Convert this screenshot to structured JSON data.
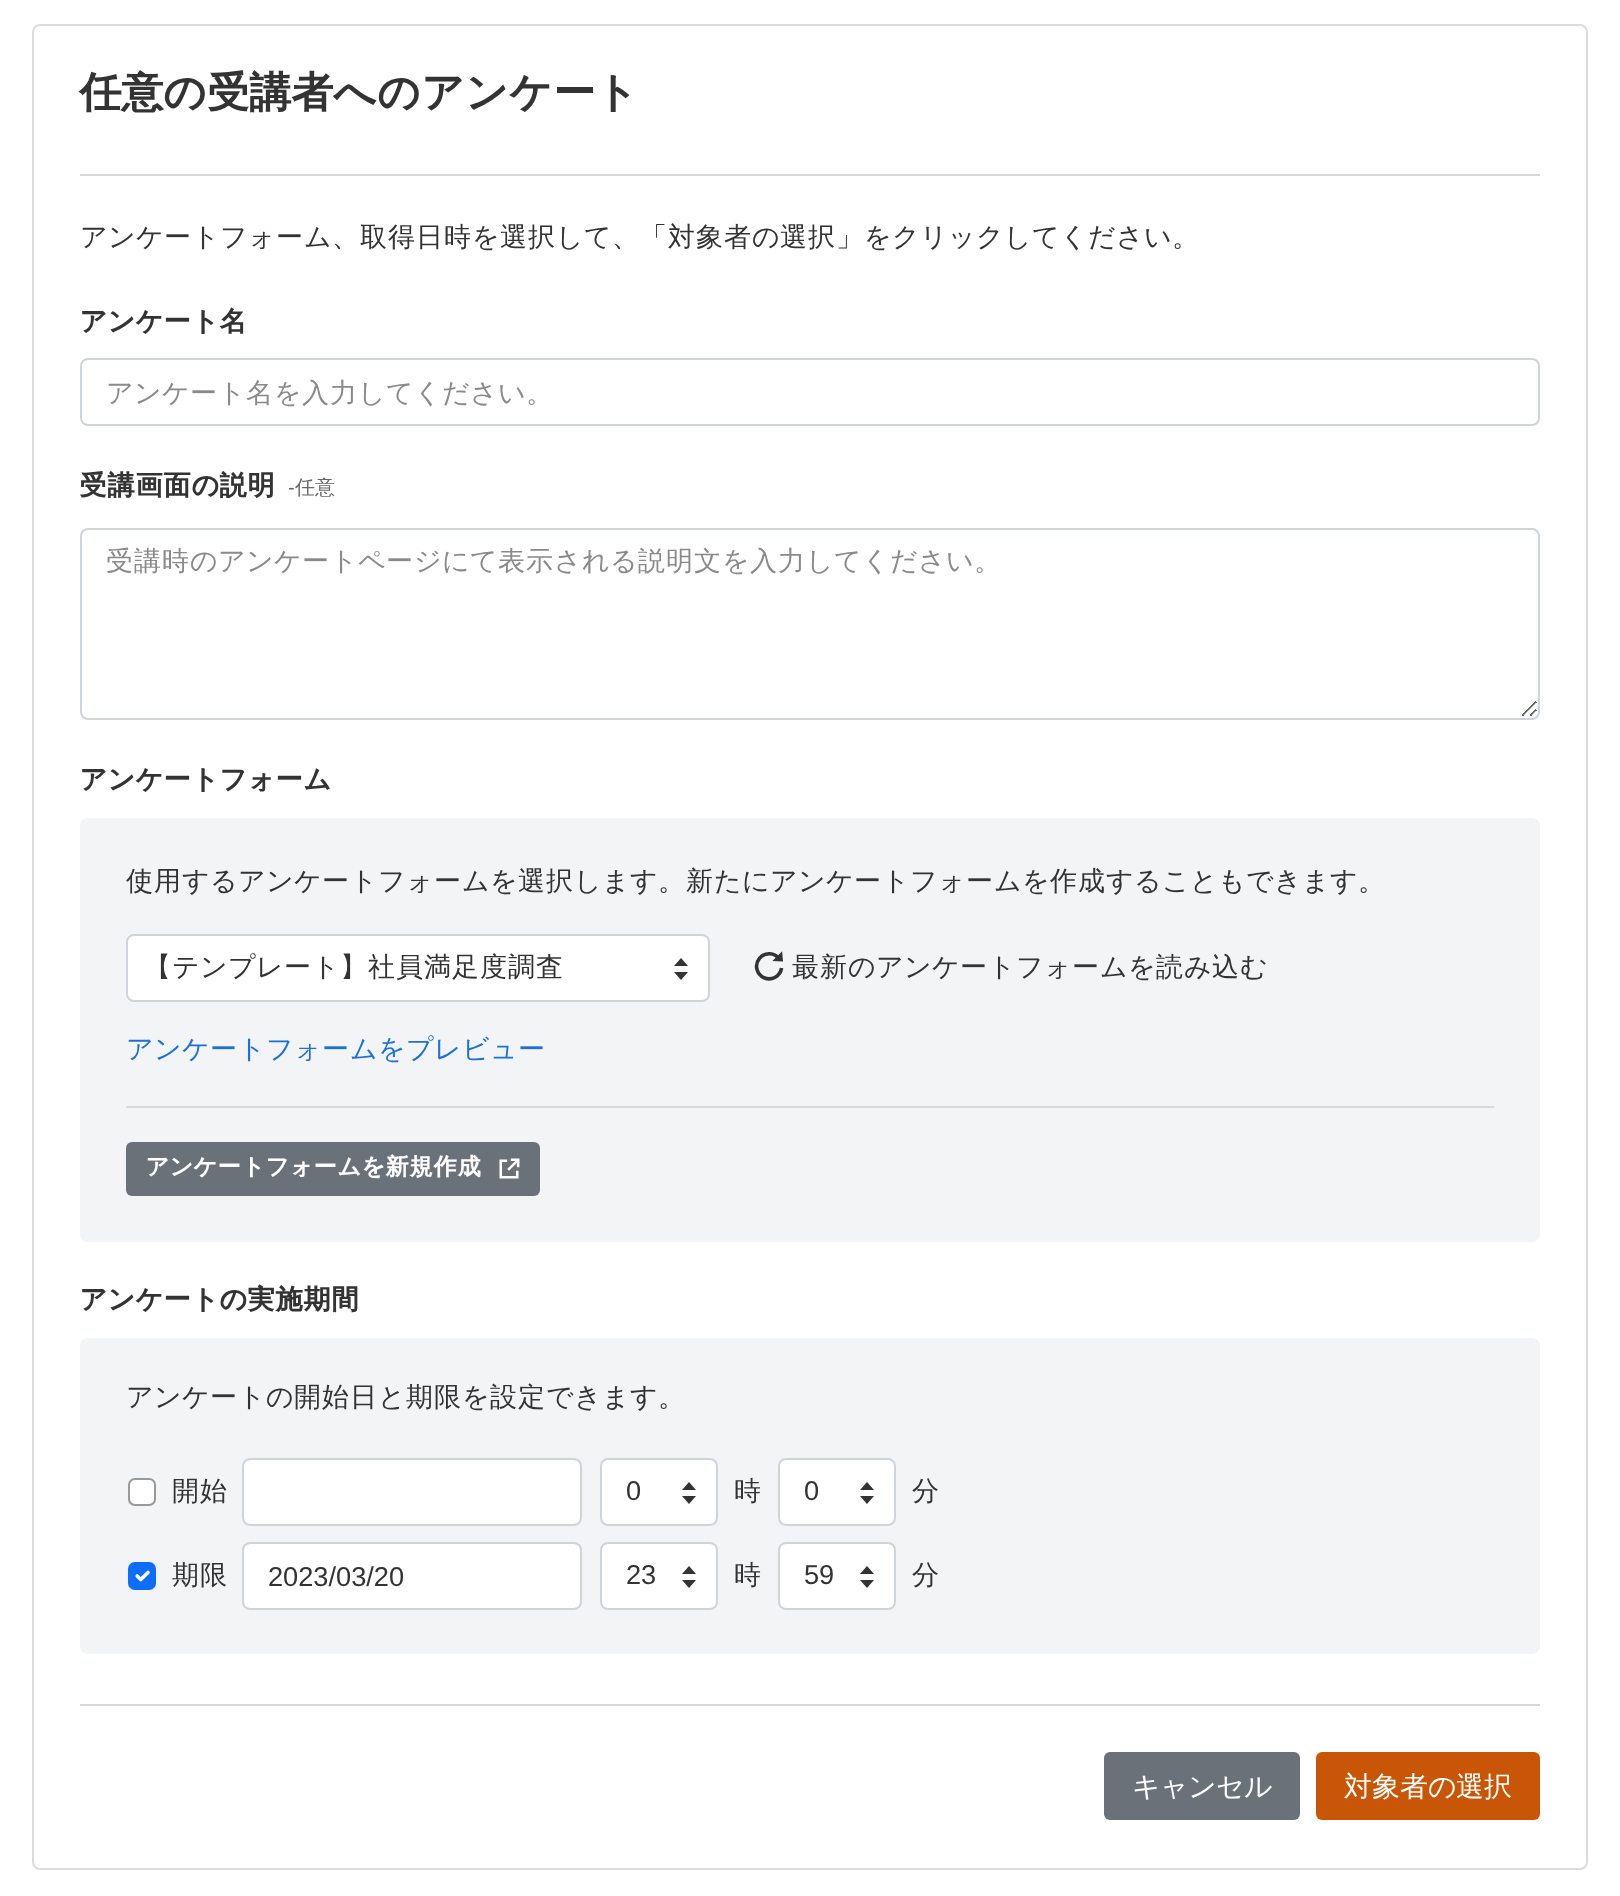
{
  "title": "任意の受講者へのアンケート",
  "instruction": "アンケートフォーム、取得日時を選択して、「対象者の選択」をクリックしてください。",
  "fields": [
    {
      "kind": "input",
      "label": "アンケート名",
      "placeholder": "アンケート名を入力してください。"
    },
    {
      "kind": "textarea",
      "label": "受講画面の説明",
      "optional_tag": "-任意",
      "placeholder": "受講時のアンケートページにて表示される説明文を入力してください。"
    }
  ],
  "form_section": {
    "heading": "アンケートフォーム",
    "description": "使用するアンケートフォームを選択します。新たにアンケートフォームを作成することもできます。",
    "select": {
      "value": "【テンプレート】社員満足度調査"
    },
    "reload_label": "最新のアンケートフォームを読み込む",
    "preview_link": "アンケートフォームをプレビュー",
    "create_button": "アンケートフォームを新規作成"
  },
  "period_section": {
    "heading": "アンケートの実施期間",
    "description": "アンケートの開始日と期限を設定できます。",
    "rows": [
      {
        "label": "開始",
        "checked": false,
        "hour": "0",
        "hour_unit": "時",
        "minute": "0",
        "minute_unit": "分"
      },
      {
        "label": "期限",
        "checked": true,
        "date": "2023/03/20",
        "hour": "23",
        "hour_unit": "時",
        "minute": "59",
        "minute_unit": "分"
      }
    ]
  },
  "buttons": [
    {
      "kind": "cancel",
      "label": "キャンセル"
    },
    {
      "kind": "submit",
      "label": "対象者の選択"
    }
  ]
}
